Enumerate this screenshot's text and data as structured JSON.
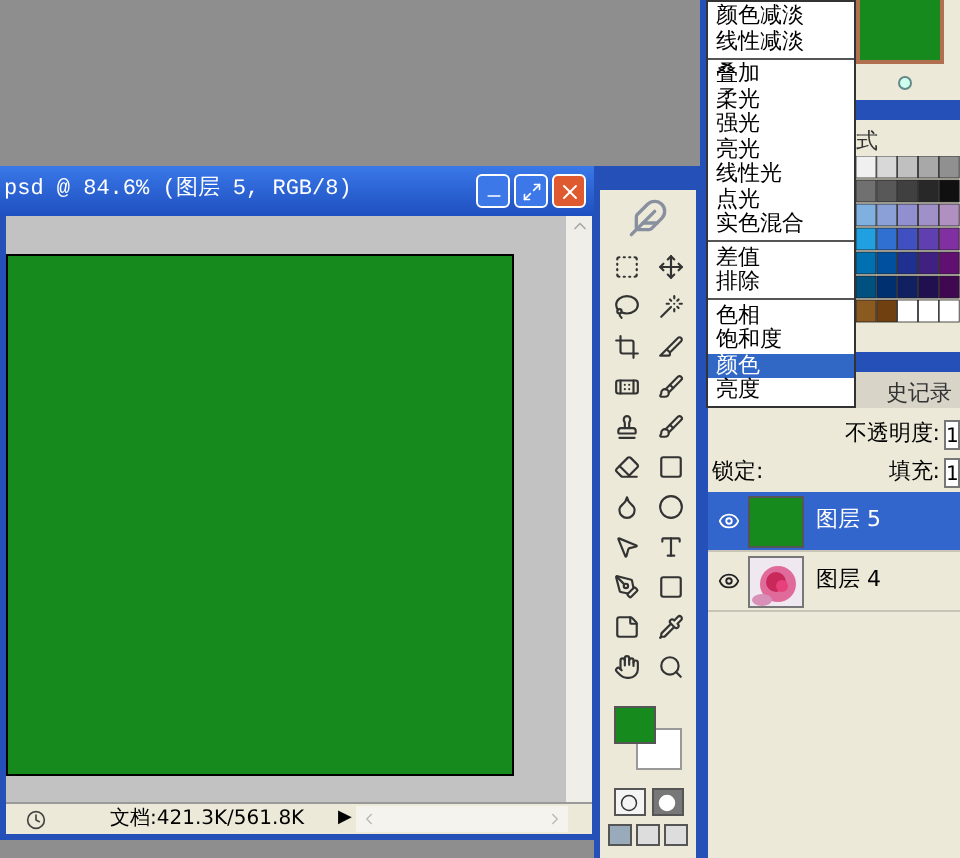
{
  "document_window": {
    "title": "psd @ 84.6% (图层 5, RGB/8)",
    "status": "文档:421.3K/561.8K",
    "status_arrow": "▶"
  },
  "swatches_panel": {
    "tab": "式"
  },
  "blend_menu": {
    "items": [
      {
        "kind": "item",
        "label": "颜色减淡",
        "selected": false
      },
      {
        "kind": "item",
        "label": "线性减淡",
        "selected": false
      },
      {
        "kind": "separator"
      },
      {
        "kind": "item",
        "label": "叠加",
        "selected": false
      },
      {
        "kind": "item",
        "label": "柔光",
        "selected": false
      },
      {
        "kind": "item",
        "label": "强光",
        "selected": false
      },
      {
        "kind": "item",
        "label": "亮光",
        "selected": false
      },
      {
        "kind": "item",
        "label": "线性光",
        "selected": false
      },
      {
        "kind": "item",
        "label": "点光",
        "selected": false
      },
      {
        "kind": "item",
        "label": "实色混合",
        "selected": false
      },
      {
        "kind": "separator"
      },
      {
        "kind": "item",
        "label": "差值",
        "selected": false
      },
      {
        "kind": "item",
        "label": "排除",
        "selected": false
      },
      {
        "kind": "separator"
      },
      {
        "kind": "item",
        "label": "色相",
        "selected": false
      },
      {
        "kind": "item",
        "label": "饱和度",
        "selected": false
      },
      {
        "kind": "item",
        "label": "颜色",
        "selected": true
      },
      {
        "kind": "item",
        "label": "亮度",
        "selected": false
      }
    ]
  },
  "layers_panel": {
    "tab": "史记录",
    "opacity_label": "不透明度:",
    "opacity_value": "1",
    "lock_label": "锁定:",
    "fill_label": "填充:",
    "fill_value": "1",
    "layers": [
      {
        "name": "图层 5",
        "selected": true,
        "visible": true,
        "kind": "fill"
      },
      {
        "name": "图层 4",
        "selected": false,
        "visible": true,
        "kind": "picture"
      }
    ]
  }
}
